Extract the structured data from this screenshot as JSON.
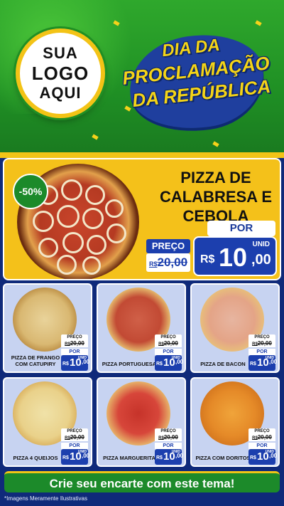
{
  "header": {
    "logo_lines": [
      "SUA",
      "LOGO",
      "AQUI"
    ],
    "banner_lines": [
      "DIA DA",
      "PROCLAMAÇÃO",
      "DA REPÚBLICA"
    ]
  },
  "featured": {
    "discount": "-50%",
    "name": "PIZZA DE CALABRESA E CEBOLA",
    "preco_label": "PREÇO",
    "old_prefix": "R$",
    "old_price": "20,00",
    "por_label": "POR",
    "unid_label": "UNID",
    "currency": "R$",
    "new_int": "10",
    "new_cents": ",00"
  },
  "cards": [
    {
      "name": "PIZZA DE FRANGO COM CATUPIRY",
      "preco_label": "PREÇO",
      "old_prefix": "R$",
      "old_price": "20,00",
      "por_label": "POR",
      "currency": "R$",
      "new_int": "10",
      "new_cents": ",00",
      "unid": "UNID"
    },
    {
      "name": "PIZZA PORTUGUESA",
      "preco_label": "PREÇO",
      "old_prefix": "R$",
      "old_price": "20,00",
      "por_label": "POR",
      "currency": "R$",
      "new_int": "10",
      "new_cents": ",00",
      "unid": "UNID"
    },
    {
      "name": "PIZZA DE BACON",
      "preco_label": "PREÇO",
      "old_prefix": "R$",
      "old_price": "20,00",
      "por_label": "POR",
      "currency": "R$",
      "new_int": "10",
      "new_cents": ",00",
      "unid": "UNID"
    },
    {
      "name": "PIZZA 4 QUEIJOS",
      "preco_label": "PREÇO",
      "old_prefix": "R$",
      "old_price": "20,00",
      "por_label": "POR",
      "currency": "R$",
      "new_int": "10",
      "new_cents": ",00",
      "unid": "UNID"
    },
    {
      "name": "PIZZA MARGUERITA",
      "preco_label": "PREÇO",
      "old_prefix": "R$",
      "old_price": "20,00",
      "por_label": "POR",
      "currency": "R$",
      "new_int": "10",
      "new_cents": ",00",
      "unid": "UNID"
    },
    {
      "name": "PIZZA COM DORITOS",
      "preco_label": "PREÇO",
      "old_prefix": "R$",
      "old_price": "20,00",
      "por_label": "POR",
      "currency": "R$",
      "new_int": "10",
      "new_cents": ",00",
      "unid": "UNID"
    }
  ],
  "cta": "Crie seu encarte com este tema!",
  "footnote": "*Imagens Meramente Ilustrativas",
  "colors": {
    "green": "#1f8f24",
    "yellow": "#f4c11a",
    "blue": "#1c3fae",
    "card_bg": "#c7d3f1"
  }
}
